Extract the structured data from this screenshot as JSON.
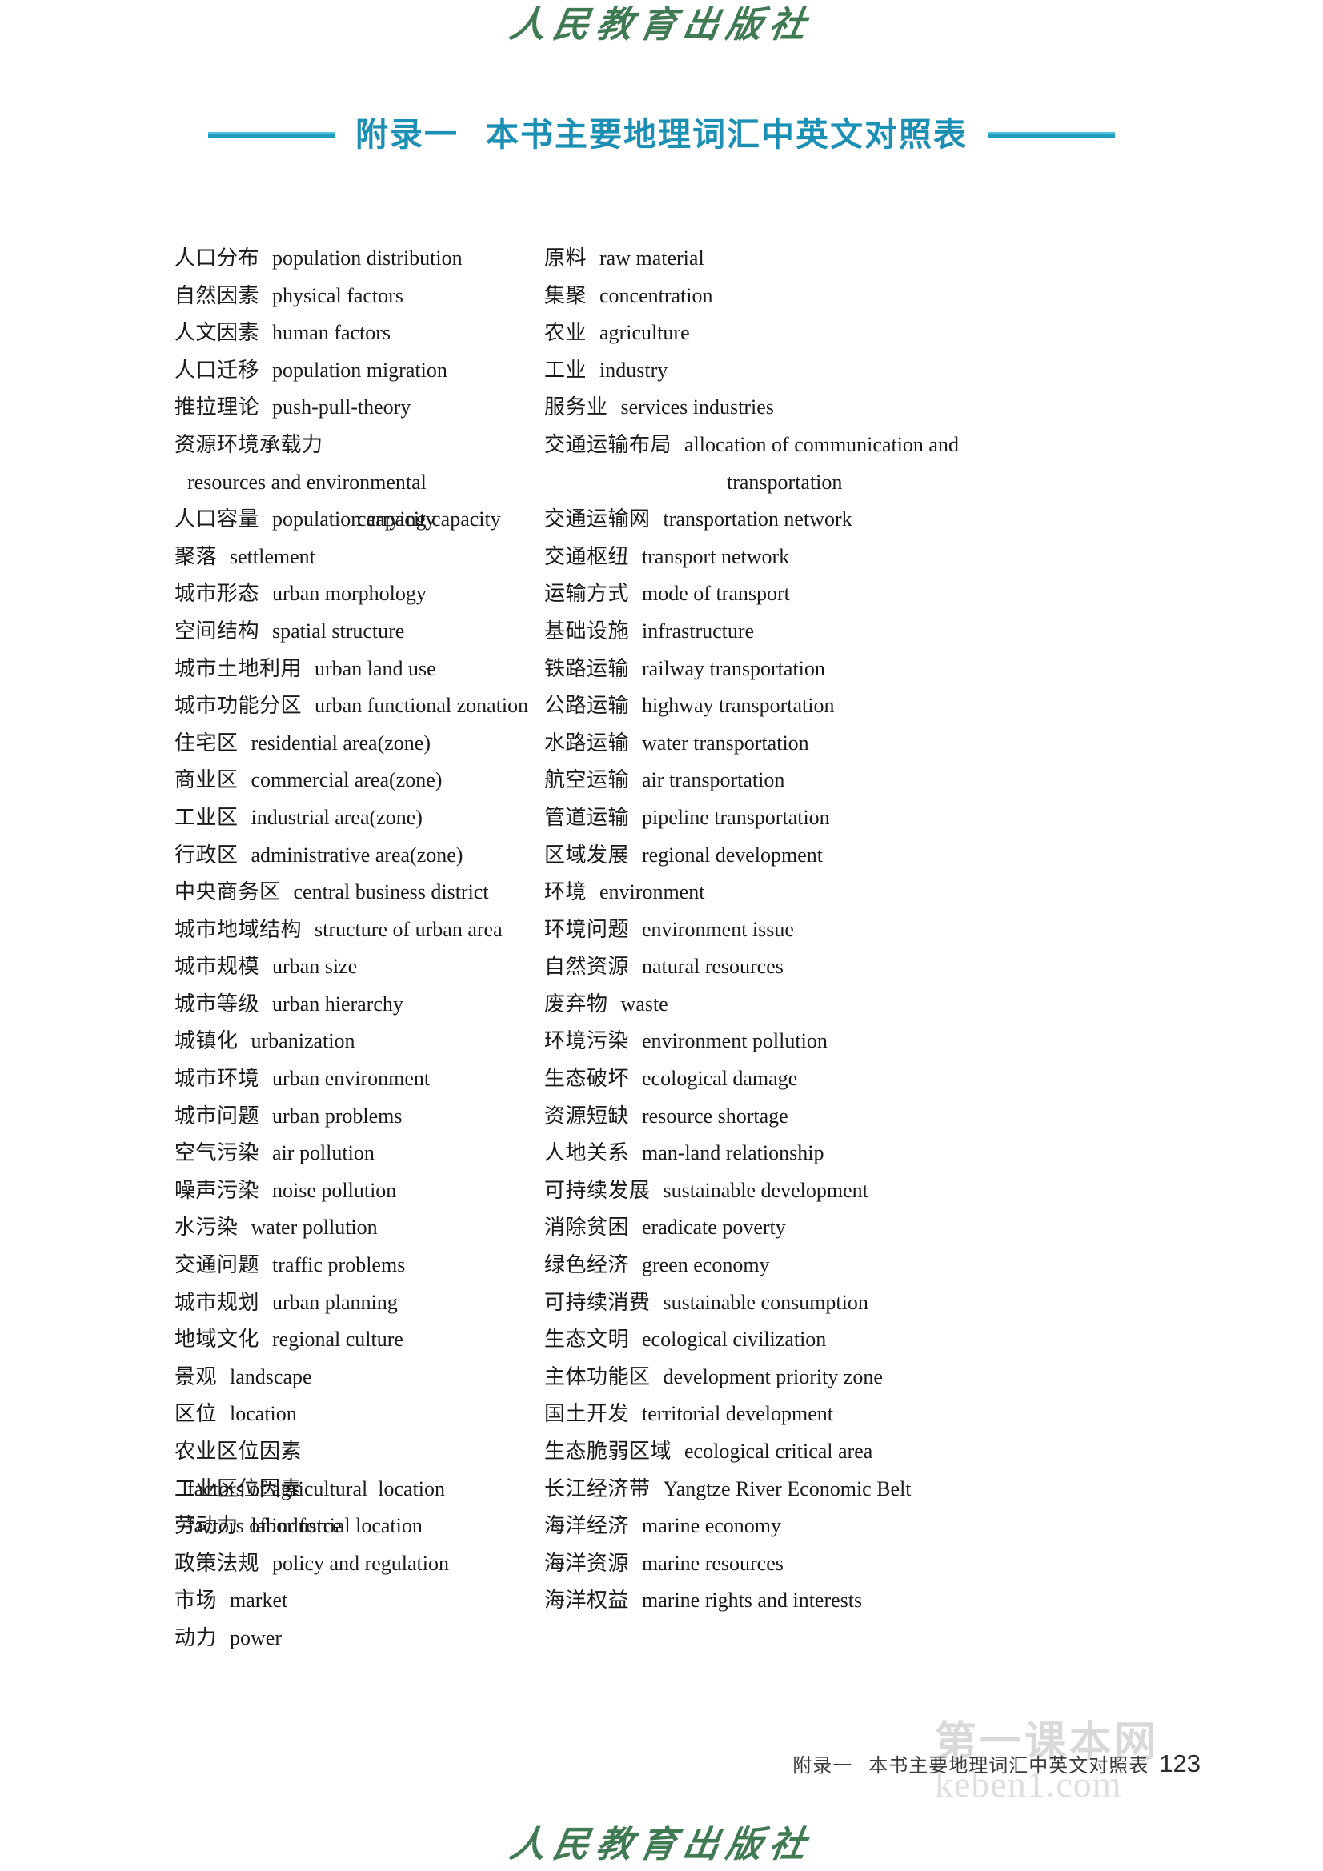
{
  "publisher": {
    "name": "人民教育出版社"
  },
  "title": {
    "prefix": "附录一",
    "main": "本书主要地理词汇中英文对照表"
  },
  "glossary": {
    "left_column": [
      {
        "term": "人口分布",
        "gloss": "population distribution"
      },
      {
        "term": "自然因素",
        "gloss": "physical factors"
      },
      {
        "term": "人文因素",
        "gloss": "human factors"
      },
      {
        "term": "人口迁移",
        "gloss": "population migration"
      },
      {
        "term": "推拉理论",
        "gloss": "push-pull-theory"
      },
      {
        "term": "资源环境承载力",
        "gloss": "resources and environmental",
        "gloss_cont": "carrying capacity"
      },
      {
        "term": "人口容量",
        "gloss": "population capacity"
      },
      {
        "term": "聚落",
        "gloss": "settlement"
      },
      {
        "term": "城市形态",
        "gloss": "urban morphology"
      },
      {
        "term": "空间结构",
        "gloss": "spatial structure"
      },
      {
        "term": "城市土地利用",
        "gloss": "urban land use"
      },
      {
        "term": "城市功能分区",
        "gloss": "urban functional zonation"
      },
      {
        "term": "住宅区",
        "gloss": "residential area(zone)"
      },
      {
        "term": "商业区",
        "gloss": "commercial area(zone)"
      },
      {
        "term": "工业区",
        "gloss": "industrial area(zone)"
      },
      {
        "term": "行政区",
        "gloss": "administrative area(zone)"
      },
      {
        "term": "中央商务区",
        "gloss": "central business district"
      },
      {
        "term": "城市地域结构",
        "gloss": "structure of urban area"
      },
      {
        "term": "城市规模",
        "gloss": "urban size"
      },
      {
        "term": "城市等级",
        "gloss": "urban hierarchy"
      },
      {
        "term": "城镇化",
        "gloss": "urbanization"
      },
      {
        "term": "城市环境",
        "gloss": "urban environment"
      },
      {
        "term": "城市问题",
        "gloss": "urban problems"
      },
      {
        "term": "空气污染",
        "gloss": "air pollution"
      },
      {
        "term": "噪声污染",
        "gloss": "noise pollution"
      },
      {
        "term": "水污染",
        "gloss": "water pollution"
      },
      {
        "term": "交通问题",
        "gloss": "traffic problems"
      },
      {
        "term": "城市规划",
        "gloss": "urban planning"
      },
      {
        "term": "地域文化",
        "gloss": "regional culture"
      },
      {
        "term": "景观",
        "gloss": "landscape"
      },
      {
        "term": "区位",
        "gloss": "location"
      },
      {
        "term": "农业区位因素",
        "gloss": "factors of agricultural  location"
      },
      {
        "term": "工业区位因素",
        "gloss": "factors of industrial location"
      },
      {
        "term": "劳动力",
        "gloss": "labor force"
      },
      {
        "term": "政策法规",
        "gloss": "policy and regulation"
      },
      {
        "term": "市场",
        "gloss": "market"
      },
      {
        "term": "动力",
        "gloss": "power"
      }
    ],
    "right_column": [
      {
        "term": "原料",
        "gloss": "raw material"
      },
      {
        "term": "集聚",
        "gloss": "concentration"
      },
      {
        "term": "农业",
        "gloss": "agriculture"
      },
      {
        "term": "工业",
        "gloss": "industry"
      },
      {
        "term": "服务业",
        "gloss": "services industries"
      },
      {
        "term": "交通运输布局",
        "gloss": "allocation of communication and",
        "gloss_cont": "transportation"
      },
      {
        "term": "交通运输网",
        "gloss": "transportation network"
      },
      {
        "term": "交通枢纽",
        "gloss": "transport network"
      },
      {
        "term": "运输方式",
        "gloss": "mode of transport"
      },
      {
        "term": "基础设施",
        "gloss": "infrastructure"
      },
      {
        "term": "铁路运输",
        "gloss": "railway transportation"
      },
      {
        "term": "公路运输",
        "gloss": "highway transportation"
      },
      {
        "term": "水路运输",
        "gloss": "water transportation"
      },
      {
        "term": "航空运输",
        "gloss": "air transportation"
      },
      {
        "term": "管道运输",
        "gloss": "pipeline transportation"
      },
      {
        "term": "区域发展",
        "gloss": "regional development"
      },
      {
        "term": "环境",
        "gloss": "environment"
      },
      {
        "term": "环境问题",
        "gloss": "environment issue"
      },
      {
        "term": "自然资源",
        "gloss": "natural resources"
      },
      {
        "term": "废弃物",
        "gloss": "waste"
      },
      {
        "term": "环境污染",
        "gloss": "environment pollution"
      },
      {
        "term": "生态破坏",
        "gloss": "ecological damage"
      },
      {
        "term": "资源短缺",
        "gloss": "resource shortage"
      },
      {
        "term": "人地关系",
        "gloss": "man-land relationship"
      },
      {
        "term": "可持续发展",
        "gloss": "sustainable development"
      },
      {
        "term": "消除贫困",
        "gloss": "eradicate poverty"
      },
      {
        "term": "绿色经济",
        "gloss": "green economy"
      },
      {
        "term": "可持续消费",
        "gloss": "sustainable consumption"
      },
      {
        "term": "生态文明",
        "gloss": "ecological civilization"
      },
      {
        "term": "主体功能区",
        "gloss": "development priority zone"
      },
      {
        "term": "国土开发",
        "gloss": "territorial development"
      },
      {
        "term": "生态脆弱区域",
        "gloss": "ecological critical area"
      },
      {
        "term": "长江经济带",
        "gloss": "Yangtze River Economic Belt"
      },
      {
        "term": "海洋经济",
        "gloss": "marine economy"
      },
      {
        "term": "海洋资源",
        "gloss": "marine resources"
      },
      {
        "term": "海洋权益",
        "gloss": "marine rights and interests"
      }
    ]
  },
  "footer": {
    "prefix": "附录一",
    "label": "本书主要地理词汇中英文对照表",
    "page_number": "123"
  },
  "watermark": {
    "cn": "第一课本网",
    "url": "keben1.com"
  },
  "colors": {
    "title": "#1b8fb4",
    "rule": "#1f9cbe",
    "publisher": "#3f7a52",
    "text": "#1a1a1a",
    "watermark": "#d9d9d9"
  }
}
